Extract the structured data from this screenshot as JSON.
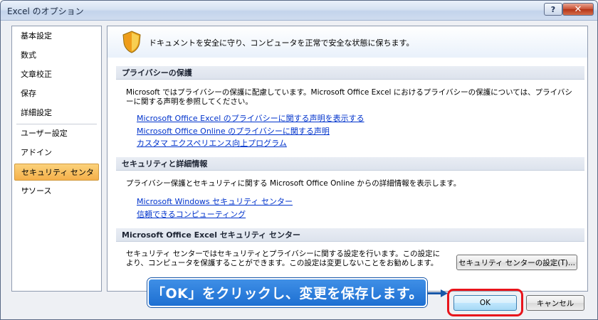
{
  "window": {
    "title": "Excel のオプション",
    "help_label": "?",
    "close_label": "✕"
  },
  "sidebar": {
    "items": [
      {
        "label": "基本設定"
      },
      {
        "label": "数式"
      },
      {
        "label": "文章校正"
      },
      {
        "label": "保存"
      },
      {
        "label": "詳細設定"
      },
      {
        "label": "ユーザー設定"
      },
      {
        "label": "アドイン"
      },
      {
        "label": "セキュリティ センター",
        "selected": true
      },
      {
        "label": "リソース"
      }
    ]
  },
  "content": {
    "header_text": "ドキュメントを安全に守り、コンピュータを正常で安全な状態に保ちます。",
    "header_icon": "shield-icon",
    "sections": [
      {
        "title": "プライバシーの保護",
        "description": "Microsoft ではプライバシーの保護に配慮しています。Microsoft Office Excel におけるプライバシーの保護については、プライバシーに関する声明を参照してください。",
        "links": [
          "Microsoft Office Excel のプライバシーに関する声明を表示する",
          "Microsoft Office Online のプライバシーに関する声明",
          "カスタマ エクスペリエンス向上プログラム"
        ]
      },
      {
        "title": "セキュリティと詳細情報",
        "description": "プライバシー保護とセキュリティに関する Microsoft Office Online からの詳細情報を表示します。",
        "links": [
          "Microsoft Windows セキュリティ センター",
          "信頼できるコンピューティング"
        ]
      },
      {
        "title": "Microsoft Office Excel セキュリティ センター",
        "description": "セキュリティ センターではセキュリティとプライバシーに関する設定を行います。この設定により、コンピュータを保護することができます。この設定は変更しないことをお勧めします。",
        "button_label": "セキュリティ センターの設定(T)..."
      }
    ]
  },
  "footer": {
    "ok_label": "OK",
    "cancel_label": "キャンセル"
  },
  "annotation": {
    "callout_text": "「OK」をクリックし、変更を保存します。",
    "highlight_color": "#e8141b",
    "callout_color": "#1d6fd2"
  }
}
